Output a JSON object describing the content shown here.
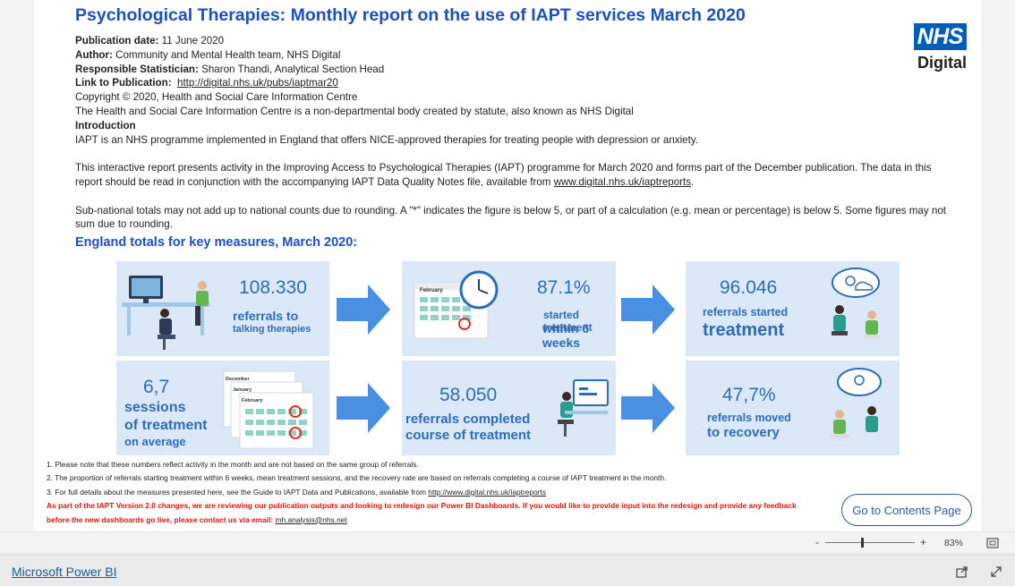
{
  "report": {
    "title": "Psychological Therapies: Monthly report on the use of IAPT services March 2020",
    "logo": {
      "box": "NHS",
      "sub": "Digital"
    },
    "meta": {
      "publication_date_label": "Publication date:",
      "publication_date": "11 June 2020",
      "author_label": "Author:",
      "author": "Community and Mental Health team, NHS Digital",
      "statistician_label": "Responsible Statistician:",
      "statistician": "Sharon Thandi, Analytical Section Head",
      "link_label": "Link to Publication:",
      "link": "http://digital.nhs.uk/pubs/iaptmar20",
      "copyright": "Copyright © 2020, Health and Social Care Information Centre",
      "hscic": "The Health and Social Care Information Centre is a non-departmental body created by statute, also known as NHS Digital",
      "intro_label": "Introduction",
      "intro": "IAPT is an NHS programme implemented in England that offers NICE-approved therapies for treating people with depression or anxiety.",
      "para2_a": "This interactive report presents activity in the Improving Access to Psychological Therapies (IAPT) programme for March 2020 and forms part of the December publication. The data in this report should be read in conjunction with the accompanying IAPT Data Quality Notes file, available from ",
      "para2_link": "www.digital.nhs.uk/iaptreports",
      "para2_b": ".",
      "para3": "Sub-national totals may not add up to national counts due to rounding. A \"*\" indicates the figure is below 5, or part of a calculation (e.g. mean or percentage) is below 5. Some figures may not sum due to rounding."
    },
    "section_heading": "England totals for key measures, March 2020:",
    "cards": {
      "referrals": {
        "value": "108.330",
        "line1": "referrals to",
        "line2": "talking therapies"
      },
      "started6": {
        "value": "87.1%",
        "line1": "started treatment",
        "line2": "within 6 weeks"
      },
      "started": {
        "value": "96.046",
        "line1": "referrals started",
        "line2": "treatment"
      },
      "sessions": {
        "value": "6,7",
        "line1": "sessions",
        "line2": "of treatment",
        "line3": "on average"
      },
      "completed": {
        "value": "58.050",
        "line1": "referrals completed",
        "line2": "course of treatment"
      },
      "recovery": {
        "value": "47,7%",
        "line1": "referrals moved",
        "line2": "to recovery"
      }
    },
    "calendar": {
      "month1": "December",
      "month2": "January",
      "month3": "February"
    },
    "notes": {
      "n1": "1. Please note that these numbers reflect activity in the month and are not based on the same group of referrals.",
      "n2": "2. The proportion of referrals starting treatment within 6 weeks, mean treatment sessions, and the recovery rate are based on referrals completing a course of IAPT treatment in the month.",
      "n3": "3. For full details about the measures presented here, see the Guide to IAPT Data and Publications, available from ",
      "n3_link": "http://www.digital.nhs.uk/iaptreports",
      "red1": "As part of the IAPT Version 2.0 changes, we are reviewing our publication outputs and looking to redesign our Power BI Dashboards. If you would like to provide input into the redesign and provide any feedback",
      "red2": "before the new dashboards go live, please contact us via email: ",
      "red_email": "mh.analysis@nhs.net"
    },
    "contents_button": "Go to Contents Page"
  },
  "zoom": {
    "minus": "-",
    "plus": "+",
    "level": "83%"
  },
  "footer": {
    "brand": "Microsoft Power BI"
  },
  "colors": {
    "title": "#1f4fbb",
    "card": "#dbe8f7",
    "arrow": "#4a90e2",
    "value": "#2e6cb5",
    "red": "#e01010"
  }
}
